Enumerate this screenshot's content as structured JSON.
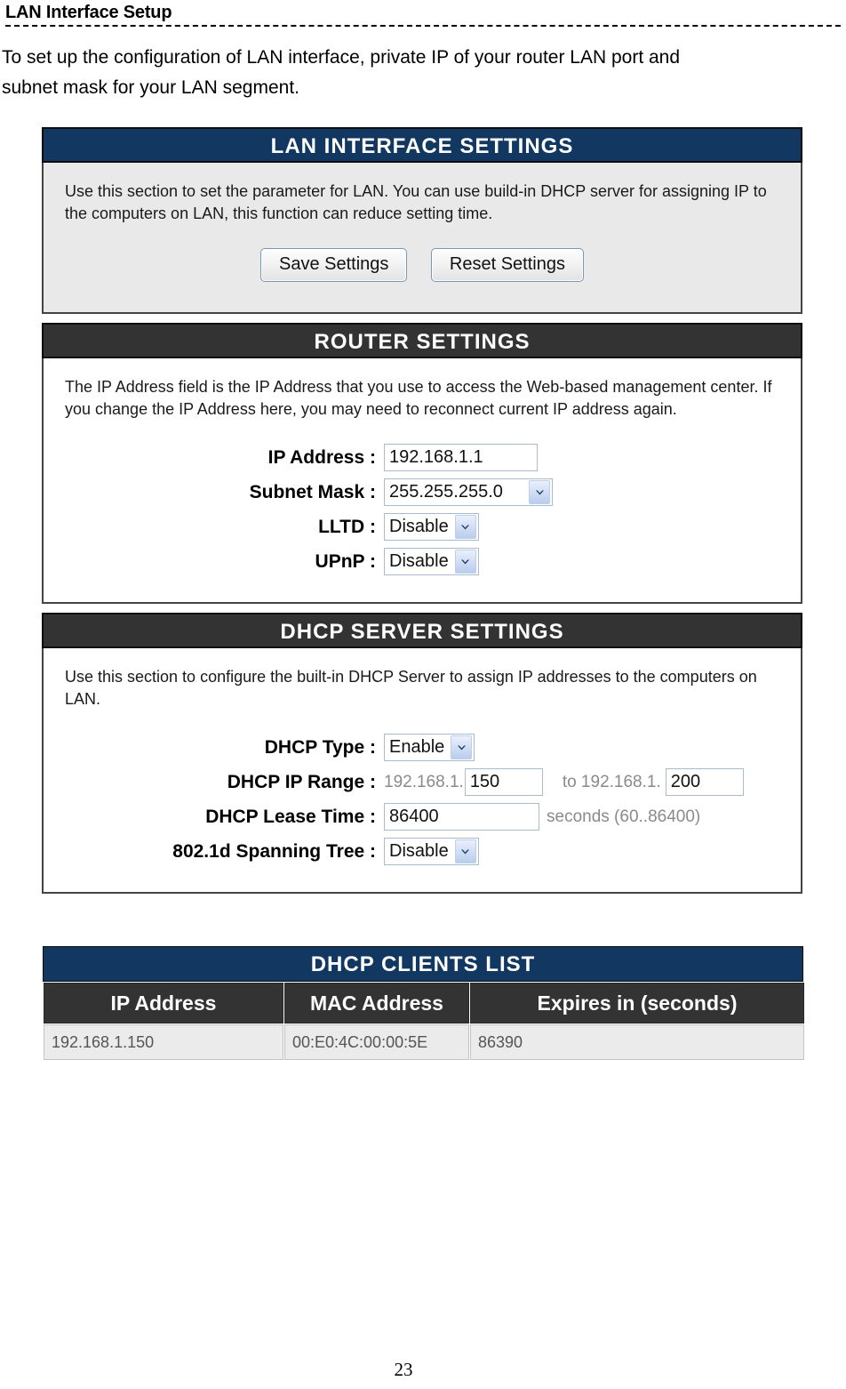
{
  "document": {
    "heading": "LAN Interface Setup",
    "intro_line1": "To set up the configuration of LAN interface, private IP of your router LAN port and",
    "intro_line2": "subnet mask for your LAN segment.",
    "page_number": "23"
  },
  "colors": {
    "navy_header": "#123760",
    "dark_header": "#333333",
    "panel_body_gray": "#e9e9e9",
    "panel_body_white": "#ffffff",
    "input_border": "#a8bcd0",
    "table_cell_bg": "#ebebeb"
  },
  "lan_interface_settings": {
    "title": "LAN INTERFACE SETTINGS",
    "description": "Use this section to set the parameter for LAN. You can use build-in DHCP server for assigning IP to the computers on LAN, this function can reduce setting time.",
    "save_button": "Save Settings",
    "reset_button": "Reset Settings"
  },
  "router_settings": {
    "title": "ROUTER SETTINGS",
    "description": "The IP Address field is the IP Address that you use to access the Web-based management center. If you change the IP Address here, you may need to reconnect current IP address again.",
    "fields": {
      "ip_address": {
        "label": "IP Address :",
        "value": "192.168.1.1",
        "placeholder": ""
      },
      "subnet_mask": {
        "label": "Subnet Mask :",
        "value": "255.255.255.0"
      },
      "lltd": {
        "label": "LLTD :",
        "value": "Disable"
      },
      "upnp": {
        "label": "UPnP :",
        "value": "Disable"
      }
    }
  },
  "dhcp_server_settings": {
    "title": "DHCP SERVER SETTINGS",
    "description": "Use this section to configure the built-in DHCP Server to assign IP addresses to the computers on LAN.",
    "fields": {
      "dhcp_type": {
        "label": "DHCP Type :",
        "value": "Enable"
      },
      "dhcp_ip_range": {
        "label": "DHCP IP Range :",
        "prefix_start": "192.168.1.",
        "start_value": "150",
        "separator": "to 192.168.1.",
        "end_value": "200"
      },
      "dhcp_lease_time": {
        "label": "DHCP Lease Time :",
        "value": "86400",
        "unit": "seconds (60..86400)"
      },
      "spanning_tree": {
        "label": "802.1d Spanning Tree :",
        "value": "Disable"
      }
    }
  },
  "dhcp_clients_list": {
    "title": "DHCP CLIENTS LIST",
    "columns": [
      "IP Address",
      "MAC Address",
      "Expires in (seconds)"
    ],
    "rows": [
      {
        "ip_address": "192.168.1.150",
        "mac_address": "00:E0:4C:00:00:5E",
        "expires": "86390"
      }
    ]
  }
}
